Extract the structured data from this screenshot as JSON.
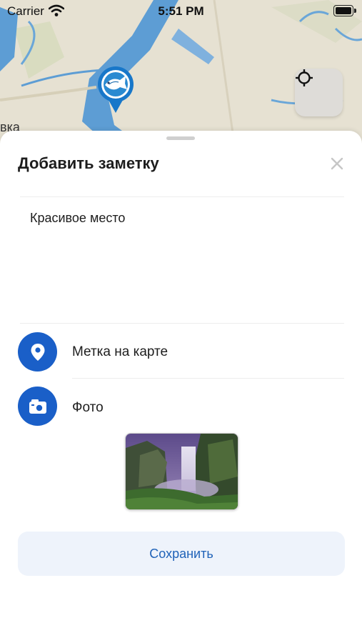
{
  "status_bar": {
    "carrier": "Carrier",
    "time": "5:51 PM"
  },
  "map": {
    "place_label": "вка"
  },
  "sheet": {
    "title": "Добавить заметку",
    "note_text": "Красивое место",
    "rows": [
      {
        "label": "Метка на карте",
        "icon": "location-pin-icon"
      },
      {
        "label": "Фото",
        "icon": "camera-icon"
      }
    ],
    "save_label": "Сохранить"
  },
  "colors": {
    "accent": "#1a5fc8",
    "button_bg": "#eef3fb",
    "button_text": "#1f62b8",
    "water": "#5b9bd3"
  }
}
